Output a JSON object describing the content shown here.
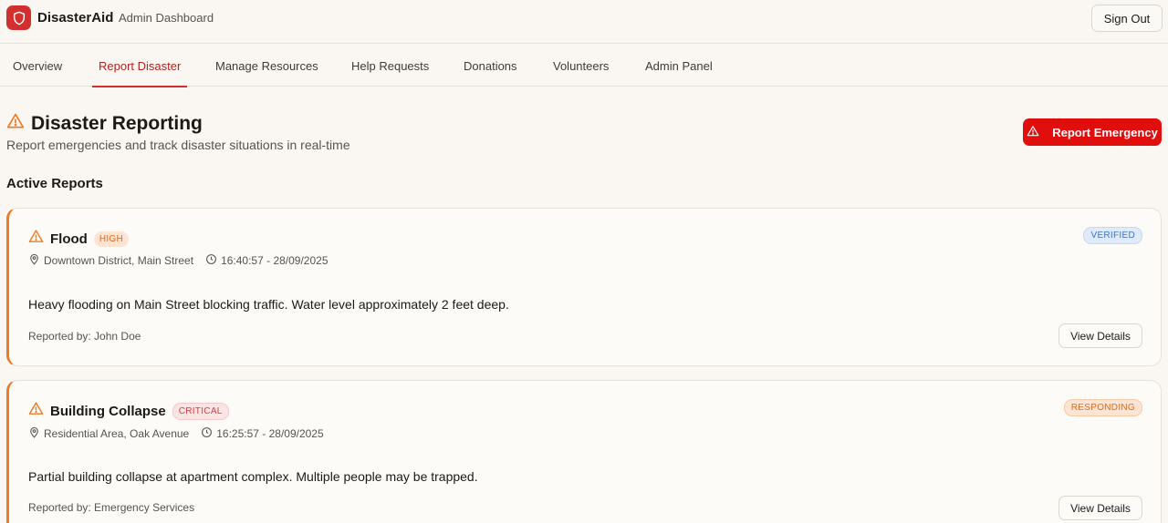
{
  "header": {
    "brand": "DisasterAid",
    "subtitle": "Admin Dashboard",
    "sign_out": "Sign Out"
  },
  "tabs": [
    {
      "label": "Overview",
      "active": false
    },
    {
      "label": "Report Disaster",
      "active": true
    },
    {
      "label": "Manage Resources",
      "active": false
    },
    {
      "label": "Help Requests",
      "active": false
    },
    {
      "label": "Donations",
      "active": false
    },
    {
      "label": "Volunteers",
      "active": false
    },
    {
      "label": "Admin Panel",
      "active": false
    }
  ],
  "page": {
    "title": "Disaster Reporting",
    "subtitle": "Report emergencies and track disaster situations in real-time",
    "report_button": "Report Emergency",
    "section_title": "Active Reports"
  },
  "reports": [
    {
      "title": "Flood",
      "severity": "HIGH",
      "status": "VERIFIED",
      "location": "Downtown District, Main Street",
      "time": "16:40:57 - 28/09/2025",
      "description": "Heavy flooding on Main Street blocking traffic. Water level approximately 2 feet deep.",
      "reporter": "Reported by: John Doe",
      "details_button": "View Details"
    },
    {
      "title": "Building Collapse",
      "severity": "CRITICAL",
      "status": "RESPONDING",
      "location": "Residential Area, Oak Avenue",
      "time": "16:25:57 - 28/09/2025",
      "description": "Partial building collapse at apartment complex. Multiple people may be trapped.",
      "reporter": "Reported by: Emergency Services",
      "details_button": "View Details"
    }
  ],
  "colors": {
    "brand": "#d42f2f",
    "emergency": "#e10e0e",
    "accent_orange": "#f07a22",
    "background": "#faf7f2"
  },
  "icons": {
    "logo": "shield-icon",
    "title": "warning-triangle-icon",
    "location": "map-pin-icon",
    "time": "clock-icon"
  }
}
